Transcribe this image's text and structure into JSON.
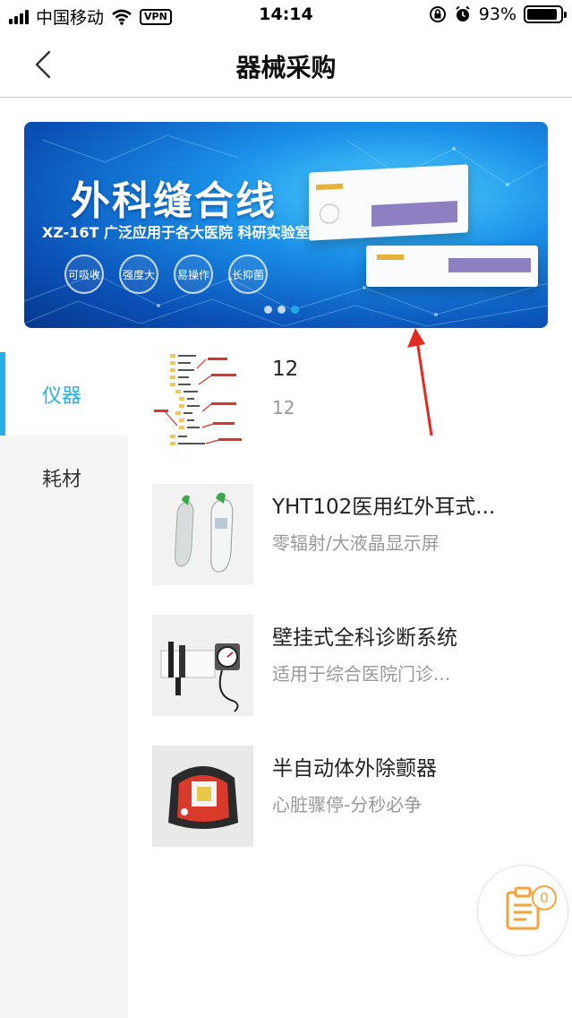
{
  "status_bar": {
    "carrier": "中国移动",
    "vpn": "VPN",
    "time": "14:14",
    "battery_percent": "93%",
    "battery_level": 0.93
  },
  "header": {
    "title": "器械采购"
  },
  "banner": {
    "title": "外科缝合线",
    "subtitle": "XZ-16T 广泛应用于各大医院 科研实验室",
    "features": [
      "可吸收",
      "强度大",
      "易操作",
      "长抑菌"
    ],
    "dots": 3,
    "active_dot": 2
  },
  "sidebar": {
    "items": [
      {
        "label": "仪器",
        "active": true
      },
      {
        "label": "耗材",
        "active": false
      }
    ]
  },
  "products": [
    {
      "name": "12",
      "desc": "12",
      "image": "screenshot-thumbnail"
    },
    {
      "name": "YHT102医用红外耳式...",
      "desc": "零辐射/大液晶显示屏",
      "image": "ear-thermometer"
    },
    {
      "name": "壁挂式全科诊断系统",
      "desc": "适用于综合医院门诊...",
      "image": "wall-diagnostic-set"
    },
    {
      "name": "半自动体外除颤器",
      "desc": "心脏骤停-分秒必争",
      "image": "aed-device"
    }
  ],
  "cart": {
    "count": "0",
    "icon": "clipboard-icon"
  },
  "colors": {
    "accent": "#29aee6",
    "cart": "#f6a23b",
    "annotation": "#e32a1f"
  }
}
